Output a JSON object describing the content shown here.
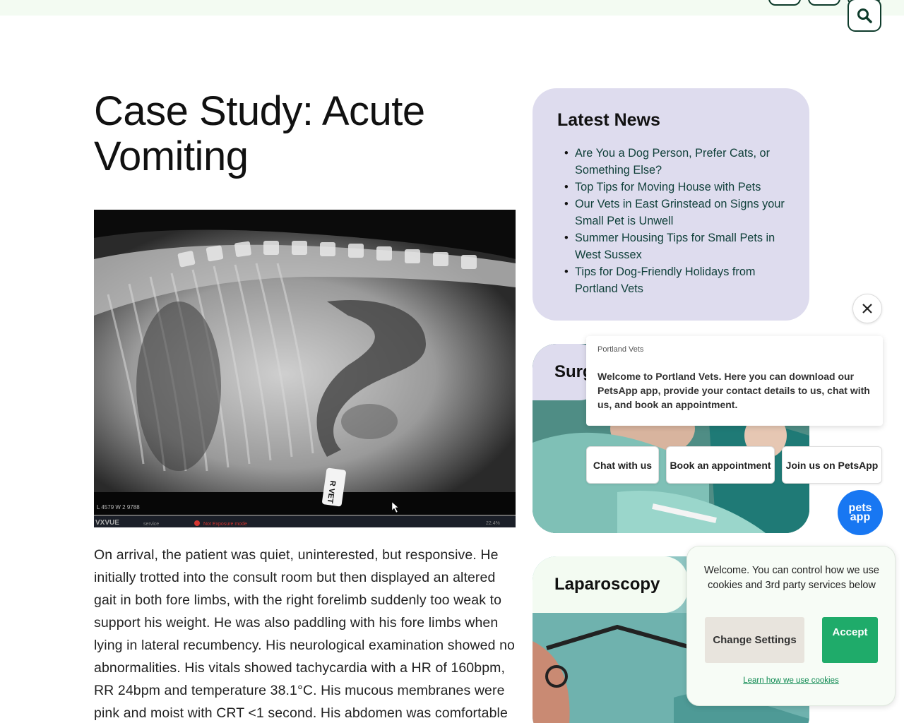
{
  "header": {
    "search_icon": "search-icon"
  },
  "article": {
    "title": "Case Study: Acute Vomiting",
    "image_overlay_text": {
      "marker": "R VET",
      "readout": "L 4579  W 2 9788",
      "brand": "VXVUE",
      "service": "service",
      "status": "Not Exposure mode",
      "zoom": "22.4%"
    },
    "body": "On arrival, the patient was quiet, uninterested, but responsive. He initially trotted into the consult room but then displayed an altered gait in both fore limbs, with the right forelimb suddenly too weak to support his weight. He was also paddling with his fore limbs when lying in lateral recumbency. His neurological examination showed no abnormalities. His vitals showed tachycardia with a HR of 160bpm, RR 24bpm and temperature 38.1°C. His mucous membranes were pink and moist with CRT <1 second. His abdomen was comfortable on"
  },
  "sidebar": {
    "news": {
      "title": "Latest News",
      "items": [
        "Are You a Dog Person, Prefer Cats, or Something Else?",
        "Top Tips for Moving House with Pets",
        "Our Vets in East Grinstead on Signs your Small Pet is Unwell",
        "Summer Housing Tips for Small Pets in West Sussex",
        "Tips for Dog-Friendly Holidays from Portland Vets"
      ]
    },
    "services": [
      {
        "title": "Surgery"
      },
      {
        "title": "Laparoscopy"
      }
    ]
  },
  "chat": {
    "sender": "Portland Vets",
    "message": "Welcome to Portland Vets. Here you can download our PetsApp app, provide your contact details to us, chat with us, and book an appointment.",
    "options": [
      "Chat with us",
      "Book an appointment",
      "Join us on PetsApp"
    ],
    "fab_line1": "pets",
    "fab_line2": "app",
    "close_icon": "close-icon"
  },
  "cookie": {
    "text": "Welcome. You can control how we use cookies and 3rd party services below",
    "change_label": "Change Settings",
    "accept_label": "Accept",
    "link_label": "Learn how we use cookies"
  },
  "colors": {
    "brand_dark": "#0e3b2b",
    "news_bg": "#dedcee",
    "accept_green": "#1fab6a",
    "link_green": "#0f8a52",
    "petsapp_blue": "#1877f2"
  }
}
